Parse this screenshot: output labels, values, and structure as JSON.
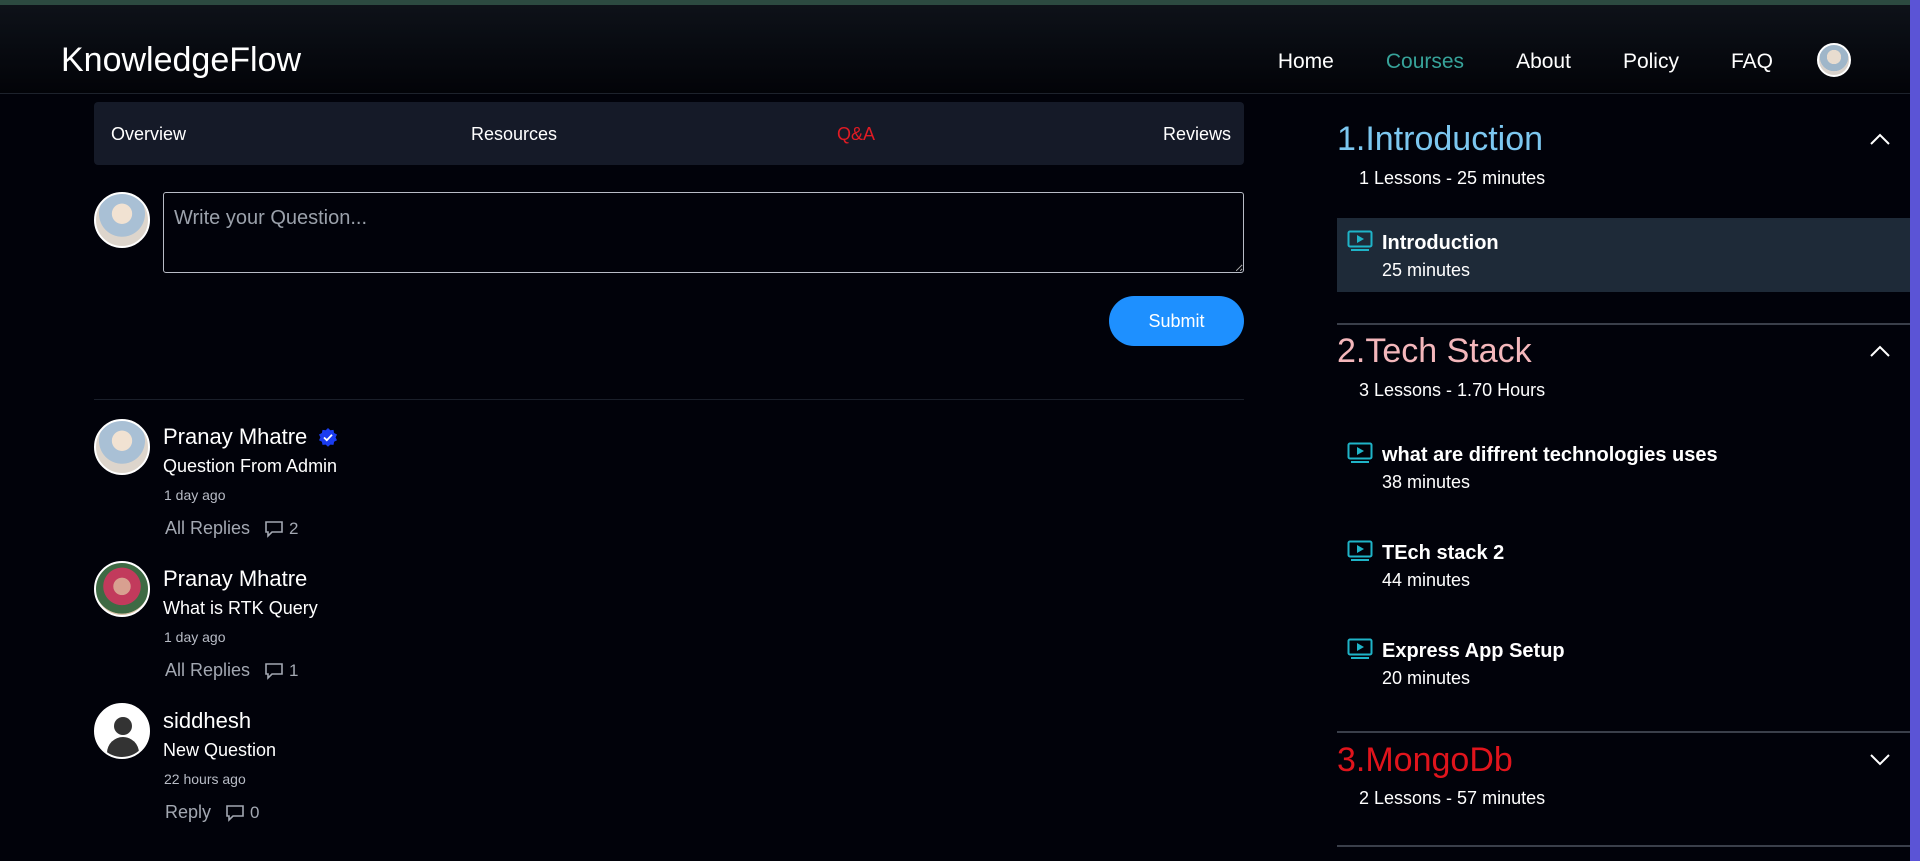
{
  "app": {
    "brand": "KnowledgeFlow"
  },
  "nav": {
    "items": [
      {
        "label": "Home",
        "active": false
      },
      {
        "label": "Courses",
        "active": true
      },
      {
        "label": "About",
        "active": false
      },
      {
        "label": "Policy",
        "active": false
      },
      {
        "label": "FAQ",
        "active": false
      }
    ]
  },
  "tabs": [
    {
      "label": "Overview",
      "active": false
    },
    {
      "label": "Resources",
      "active": false
    },
    {
      "label": "Q&A",
      "active": true
    },
    {
      "label": "Reviews",
      "active": false
    }
  ],
  "ask": {
    "placeholder": "Write your Question...",
    "submit_label": "Submit"
  },
  "questions": [
    {
      "author": "Pranay Mhatre",
      "verified": true,
      "text": "Question From Admin",
      "time": "1 day ago",
      "action": "All Replies",
      "reply_count": "2",
      "avatar": "photo"
    },
    {
      "author": "Pranay Mhatre",
      "verified": false,
      "text": "What is RTK Query",
      "time": "1 day ago",
      "action": "All Replies",
      "reply_count": "1",
      "avatar": "photo"
    },
    {
      "author": "siddhesh",
      "verified": false,
      "text": "New Question",
      "time": "22 hours ago",
      "action": "Reply",
      "reply_count": "0",
      "avatar": "default-user-icon"
    }
  ],
  "sections": [
    {
      "title": "1.Introduction",
      "color": "#7cc7f0",
      "meta": "1 Lessons - 25 minutes",
      "expanded": true,
      "lessons": [
        {
          "name": "Introduction",
          "duration": "25 minutes",
          "active": true
        }
      ]
    },
    {
      "title": "2.Tech Stack",
      "color": "#f4b7bb",
      "meta": "3 Lessons - 1.70 Hours",
      "expanded": true,
      "lessons": [
        {
          "name": "what are diffrent technologies uses",
          "duration": "38 minutes",
          "active": false
        },
        {
          "name": "TEch stack 2",
          "duration": "44 minutes",
          "active": false
        },
        {
          "name": "Express App Setup",
          "duration": "20 minutes",
          "active": false
        }
      ]
    },
    {
      "title": "3.MongoDb",
      "color": "#e0141c",
      "meta": "2 Lessons - 57 minutes",
      "expanded": false,
      "lessons": []
    }
  ],
  "colors": {
    "accent_nav": "#37a39a",
    "active_tab": "#e01b24",
    "submit": "#1e90ff",
    "lesson_icon": "#1fb4c8",
    "verified_badge": "#1a3cf0"
  }
}
